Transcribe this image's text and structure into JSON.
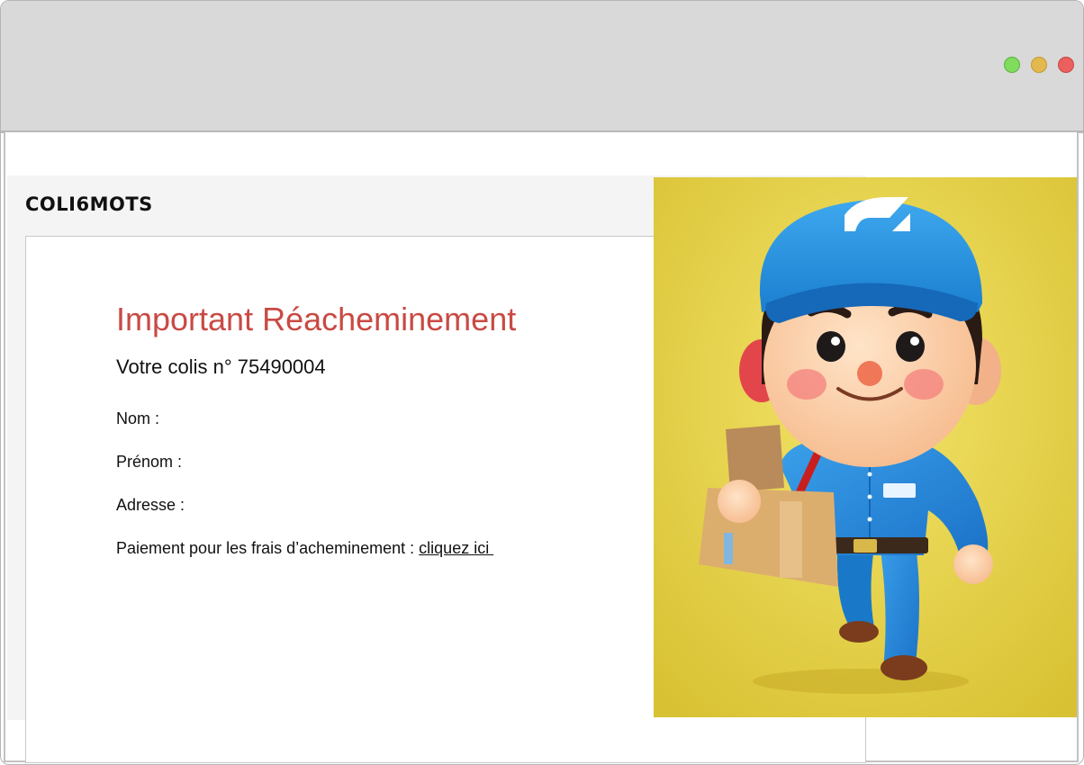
{
  "window": {
    "controls": [
      {
        "name": "maximize",
        "color": "#7fdc5c"
      },
      {
        "name": "minimize",
        "color": "#e3b84c"
      },
      {
        "name": "close",
        "color": "#eb5f5f"
      }
    ]
  },
  "site": {
    "brand": "COLI6MOTS",
    "heading": "Important Réacheminement",
    "parcel_line": "Votre colis n° 75490004",
    "fields": {
      "nom_label": "Nom :",
      "prenom_label": "Prénom :",
      "adresse_label": "Adresse :",
      "payment_label": "Paiement pour les frais d’acheminement : ",
      "payment_link": "cliquez ici "
    },
    "heading_color": "#c94a44"
  },
  "illustration": {
    "description_icon": "delivery-man-illustration"
  }
}
